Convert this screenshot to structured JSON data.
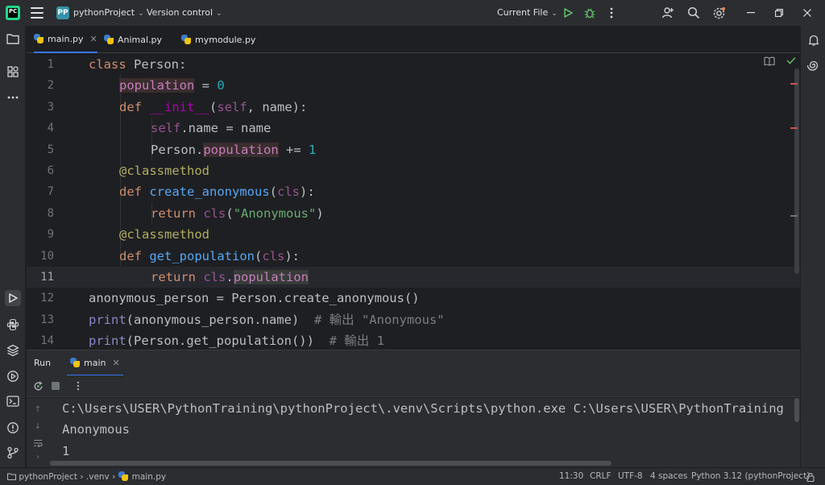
{
  "titlebar": {
    "project_badge": "PP",
    "project_name": "pythonProject",
    "version_control": "Version control",
    "run_config": "Current File"
  },
  "tabs": [
    {
      "label": "main.py",
      "active": true
    },
    {
      "label": "Animal.py",
      "active": false
    },
    {
      "label": "mymodule.py",
      "active": false
    }
  ],
  "editor": {
    "current_line": 11,
    "lines": [
      {
        "n": "1"
      },
      {
        "n": "2"
      },
      {
        "n": "3"
      },
      {
        "n": "4"
      },
      {
        "n": "5"
      },
      {
        "n": "6"
      },
      {
        "n": "7"
      },
      {
        "n": "8"
      },
      {
        "n": "9"
      },
      {
        "n": "10"
      },
      {
        "n": "11"
      },
      {
        "n": "12"
      },
      {
        "n": "13"
      },
      {
        "n": "14"
      }
    ],
    "code": {
      "l1_kw": "class",
      "l1_name": " Person:",
      "l2_var": "population",
      "l2_eq": " = ",
      "l2_num": "0",
      "l3_kw": "def",
      "l3_sp": " ",
      "l3_fn": "__init__",
      "l3_p1": "(",
      "l3_self": "self",
      "l3_p2": ", name):",
      "l4_self": "self",
      "l4_rest": ".name = name",
      "l5_a": "Person.",
      "l5_prop": "population",
      "l5_b": " += ",
      "l5_num": "1",
      "l6_dec": "@classmethod",
      "l7_kw": "def",
      "l7_sp": " ",
      "l7_fn": "create_anonymous",
      "l7_p1": "(",
      "l7_cls": "cls",
      "l7_p2": "):",
      "l8_kw": "return",
      "l8_sp": " ",
      "l8_cls": "cls",
      "l8_p1": "(",
      "l8_str": "\"Anonymous\"",
      "l8_p2": ")",
      "l9_dec": "@classmethod",
      "l10_kw": "def",
      "l10_sp": " ",
      "l10_fn": "get_population",
      "l10_p1": "(",
      "l10_cls": "cls",
      "l10_p2": "):",
      "l11_kw": "return",
      "l11_sp": " ",
      "l11_cls": "cls",
      "l11_dot": ".",
      "l11_prop": "population",
      "l12_text": "anonymous_person = Person.create_anonymous()",
      "l13_bi": "print",
      "l13_rest": "(anonymous_person.name)  ",
      "l13_cmt": "# 輸出 \"Anonymous\"",
      "l14_bi": "print",
      "l14_rest": "(Person.get_population())  ",
      "l14_cmt": "# 輸出 1"
    }
  },
  "run": {
    "title": "Run",
    "tab": "main",
    "output": [
      "C:\\Users\\USER\\PythonTraining\\pythonProject\\.venv\\Scripts\\python.exe C:\\Users\\USER\\PythonTraining",
      "Anonymous",
      "1"
    ]
  },
  "statusbar": {
    "crumb_project": "pythonProject",
    "crumb_sep": "›",
    "crumb_venv": ".venv",
    "crumb_file": "main.py",
    "position": "11:30",
    "line_ending": "CRLF",
    "encoding": "UTF-8",
    "indent": "4 spaces",
    "interpreter": "Python 3.12 (pythonProject)"
  },
  "colors": {
    "accent": "#3574f0",
    "run_green": "#5fb865",
    "keyword": "#cf8e6d",
    "function": "#56a8f5",
    "string": "#6aab73",
    "number": "#2aacb8",
    "decorator": "#b3ae60"
  }
}
